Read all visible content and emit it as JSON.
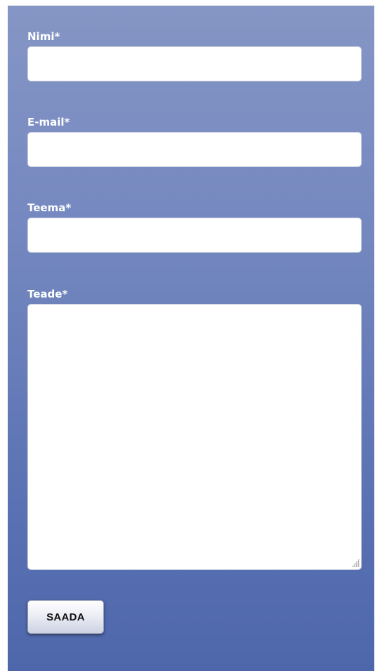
{
  "form": {
    "name_label": "Nimi*",
    "name_value": "",
    "email_label": "E-mail*",
    "email_value": "",
    "subject_label": "Teema*",
    "subject_value": "",
    "message_label": "Teade*",
    "message_value": "",
    "submit_label": "SAADA"
  },
  "colors": {
    "panel_top": "#8596c5",
    "panel_bottom": "#4e67ab",
    "label_text": "#ffffff",
    "field_background": "#ffffff"
  },
  "icons": {
    "resize_grip": "resize-grip-icon"
  }
}
